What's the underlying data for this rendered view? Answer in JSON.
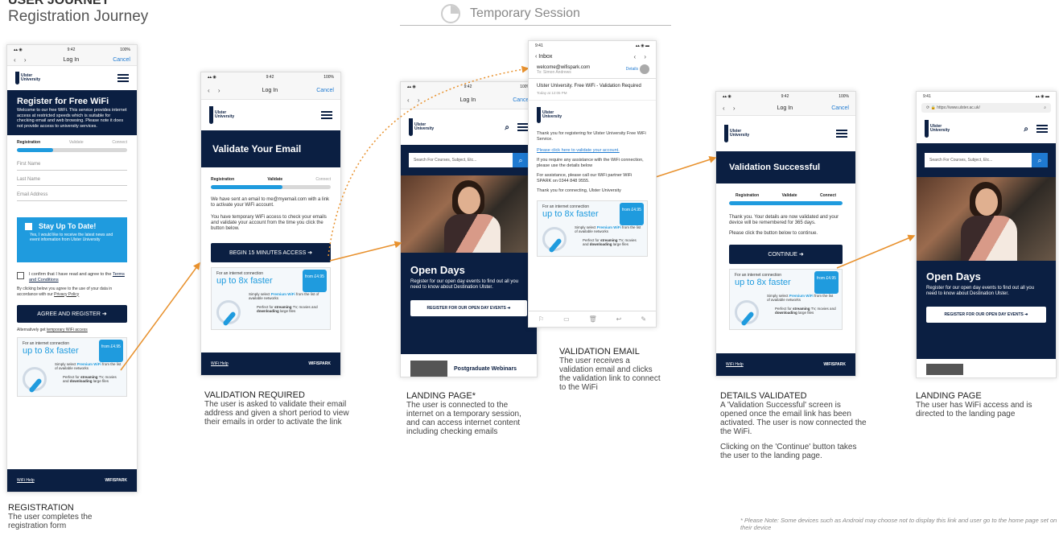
{
  "header": {
    "title": "USER JOURNEY",
    "subtitle": "Registration Journey"
  },
  "session": {
    "label": "Temporary Session"
  },
  "common": {
    "status_time_a": "9:42",
    "status_time_b": "9:41",
    "status_batt": "100%",
    "nav_title": "Log In",
    "nav_cancel": "Cancel",
    "logo_line1": "Ulster",
    "logo_line2": "University",
    "steps": [
      "Registration",
      "Validate",
      "Connect"
    ],
    "wifi_line1": "For an internet connection",
    "wifi_line2": "up to 8x faster",
    "wifi_badge": "from £4.95",
    "wifi_line3_pre": "Simply select",
    "wifi_line3_brand": "Premium WiFi",
    "wifi_line3_post": "from the list of available networks",
    "wifi_line4_pre": "Perfect for",
    "wifi_line4_b1": "streaming",
    "wifi_line4_mid": "TV, movies and",
    "wifi_line4_b2": "downloading",
    "wifi_line4_post": "large files",
    "footer_help": "WiFi Help",
    "footer_brand": "WIFISPARK",
    "search_placeholder": "Search For Courses, Subject, Etc...",
    "opendays_title": "Open Days",
    "opendays_text": "Register for our open day events to find out all you need to know about Destination Ulster.",
    "opendays_btn": "REGISTER FOR OUR OPEN DAY EVENTS",
    "postgrad": "Postgraduate Webinars"
  },
  "registration": {
    "title": "Register for Free WiFi",
    "intro": "Welcome to our free WiFi. This service provides internet access at restricted speeds which is suitable for checking email and web browsing. Please note it does not provide access to university services.",
    "fields": [
      "First Name",
      "Last Name",
      "Email Address"
    ],
    "stay_title": "Stay Up To Date!",
    "stay_text": "Yes, I would like to receive the latest news and event information from Ulster University",
    "confirm_pre": "I confirm that I have read and agree to the",
    "confirm_link": "Terms and Conditions",
    "privacy_pre": "By clicking below you agree to the use of your data in accordance with our",
    "privacy_link": "Privacy Policy",
    "button": "AGREE AND REGISTER",
    "alt_pre": "Alternatively get",
    "alt_link": "temporary WiFi access",
    "caption_title": "REGISTRATION",
    "caption_text": "The user completes the registration form"
  },
  "validate": {
    "title": "Validate Your Email",
    "text1": "We have sent an email to me@myemail.com with a link to activate your WiFi account.",
    "text2": "You have temporary WiFi access to check your emails and validate your account from the time you click the button below.",
    "button": "BEGIN 15 MINUTES ACCESS",
    "progress": 0.6,
    "caption_title": "VALIDATION REQUIRED",
    "caption_text": "The user is asked to validate their email address and given a short period to view their emails in order to activate the link"
  },
  "landing1": {
    "caption_title": "LANDING PAGE*",
    "caption_text": "The user is connected to the internet on a temporary session, and can access internet content including checking emails"
  },
  "email": {
    "inbox": "Inbox",
    "from": "welcome@wifispark.com",
    "to": "To: Simon Andrews",
    "details": "Details",
    "subject": "Ulster University. Free WiFi - Validation Required",
    "date": "Today at 12:05 PM",
    "thanks": "Thank you for registering for Ulster University Free WiFi Service.",
    "link": "Please click here to validate your account.",
    "assist1": "If you require any assistance with the WiFi connection, please use the details below",
    "assist2": "For assistance, please call our WiFi partner WiFi SPARK on 0344 848 9555.",
    "signoff": "Thank you for connecting, Ulster University",
    "caption_title": "VALIDATION EMAIL",
    "caption_text": "The user receives a validation email and clicks the validation link to connect to the WiFi"
  },
  "success": {
    "title": "Validation Successful",
    "text1": "Thank you. Your details are now validated and your device will be remembered for 365 days.",
    "text2": "Please click the button below to continue.",
    "button": "CONTINUE",
    "progress": 1.0,
    "caption_title": "DETAILS VALIDATED",
    "caption_text1": "A 'Validation Successful' screen is opened once the email link has been activated. The user is now connected the the WiFi.",
    "caption_text2": "Clicking on the 'Continue' button takes the user to the landing page."
  },
  "landing2": {
    "url": "https://www.ulster.ac.uk/",
    "caption_title": "LANDING PAGE",
    "caption_text": "The user has WiFi access and is directed to the landing page"
  },
  "note": "* Please Note: Some devices such as Android may choose not to display this link and user go to the home page set on their device",
  "colors": {
    "navy": "#0b1f42",
    "accent_blue": "#1f9bde",
    "arrow": "#e8912d"
  }
}
